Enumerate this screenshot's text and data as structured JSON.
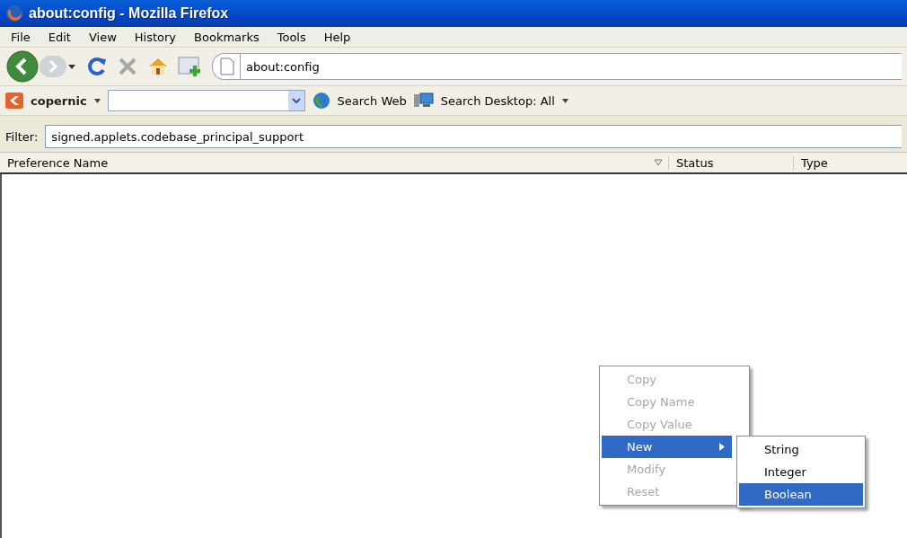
{
  "window": {
    "title": "about:config - Mozilla Firefox"
  },
  "menu_bar": [
    "File",
    "Edit",
    "View",
    "History",
    "Bookmarks",
    "Tools",
    "Help"
  ],
  "nav_toolbar": {
    "address": "about:config"
  },
  "search_toolbar": {
    "brand": "copernic",
    "search_web": "Search Web",
    "search_desktop": "Search Desktop: All"
  },
  "filter": {
    "label": "Filter:",
    "value": "signed.applets.codebase_principal_support"
  },
  "table": {
    "columns": [
      "Preference Name",
      "Status",
      "Type"
    ]
  },
  "context_menu": {
    "items": [
      {
        "label": "Copy",
        "disabled": true,
        "selected": false,
        "submenu": false
      },
      {
        "label": "Copy Name",
        "disabled": true,
        "selected": false,
        "submenu": false
      },
      {
        "label": "Copy Value",
        "disabled": true,
        "selected": false,
        "submenu": false
      },
      {
        "label": "New",
        "disabled": false,
        "selected": true,
        "submenu": true
      },
      {
        "label": "Modify",
        "disabled": true,
        "selected": false,
        "submenu": false
      },
      {
        "label": "Reset",
        "disabled": true,
        "selected": false,
        "submenu": false
      }
    ],
    "submenu": [
      {
        "label": "String",
        "selected": false
      },
      {
        "label": "Integer",
        "selected": false
      },
      {
        "label": "Boolean",
        "selected": true
      }
    ]
  }
}
